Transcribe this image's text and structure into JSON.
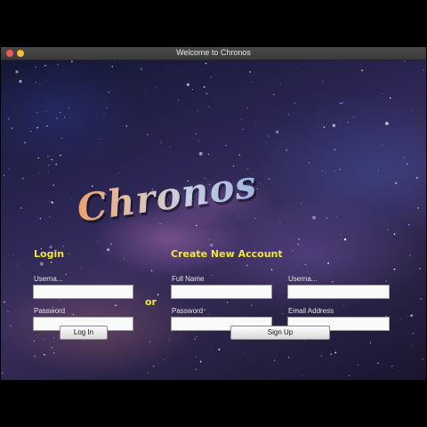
{
  "window": {
    "title": "Welcome to Chronos"
  },
  "logo": {
    "text": "Chronos"
  },
  "login": {
    "heading": "Login",
    "username_label": "Userna...",
    "username_value": "",
    "password_label": "Password",
    "password_value": "",
    "button_label": "Log In"
  },
  "divider": {
    "text": "or"
  },
  "signup": {
    "heading": "Create New Account",
    "fullname_label": "Full Name",
    "fullname_value": "",
    "username_label": "Userna...",
    "username_value": "",
    "password_label": "Password",
    "password_value": "",
    "email_label": "Email Address",
    "email_value": "",
    "button_label": "Sign Up"
  },
  "colors": {
    "heading": "#f2e63a",
    "close": "#ed5b57",
    "minimize": "#f5be3b"
  }
}
